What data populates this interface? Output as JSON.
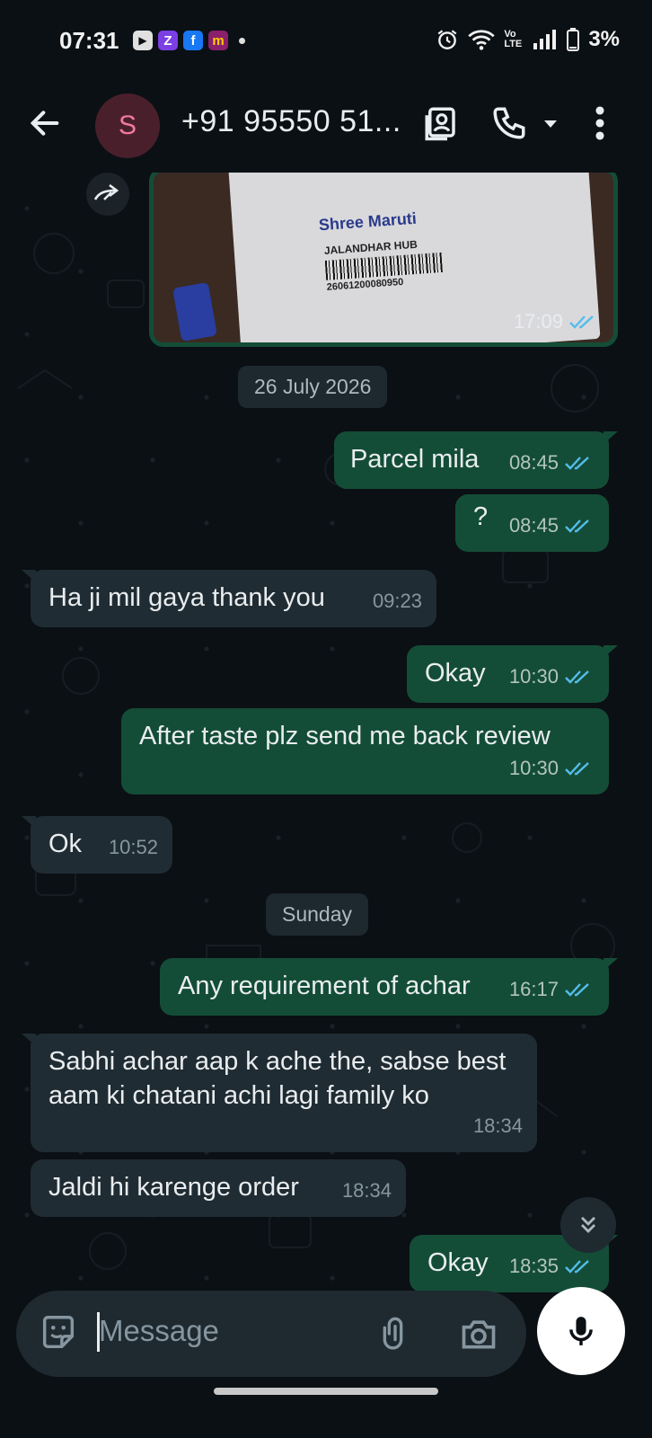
{
  "status_bar": {
    "time": "07:31",
    "apps": [
      {
        "name": "youtube-icon",
        "glyph": "▶",
        "color": "#e0e0e0"
      },
      {
        "name": "zomato-z-icon",
        "glyph": "Z",
        "color": "#7b3fe4"
      },
      {
        "name": "facebook-icon",
        "glyph": "f",
        "color": "#1877f2"
      },
      {
        "name": "meesho-icon",
        "glyph": "m",
        "color": "#8a1f6b"
      }
    ],
    "volte": "Vo LTE",
    "battery": "3%"
  },
  "header": {
    "avatar_letter": "S",
    "contact": "+91 95550 51..."
  },
  "chat": {
    "image_message": {
      "time": "17:09",
      "brand": "Shree Maruti",
      "hub": "JALANDHAR HUB",
      "barcode": "26061200080950"
    },
    "date_chip_1": "26 July 2026",
    "date_chip_2": "Sunday",
    "messages": [
      {
        "dir": "out",
        "text": "Parcel mila",
        "time": "08:45"
      },
      {
        "dir": "out",
        "text": "?",
        "time": "08:45"
      },
      {
        "dir": "in",
        "text": "Ha ji mil gaya thank you",
        "time": "09:23"
      },
      {
        "dir": "out",
        "text": "Okay",
        "time": "10:30"
      },
      {
        "dir": "out",
        "text": "After taste plz send me back review",
        "time": "10:30"
      },
      {
        "dir": "in",
        "text": "Ok",
        "time": "10:52"
      },
      {
        "dir": "out",
        "text": "Any requirement of achar",
        "time": "16:17"
      },
      {
        "dir": "in",
        "text": "Sabhi achar aap k ache the, sabse best aam ki chatani achi lagi family ko",
        "time": "18:34"
      },
      {
        "dir": "in",
        "text": "Jaldi hi karenge order",
        "time": "18:34"
      },
      {
        "dir": "out",
        "text": "Okay",
        "time": "18:35"
      }
    ]
  },
  "composer": {
    "placeholder": "Message"
  },
  "colors": {
    "background": "#0b1014",
    "outgoing": "#144d37",
    "incoming": "#202c33",
    "read_tick": "#53bdeb"
  }
}
